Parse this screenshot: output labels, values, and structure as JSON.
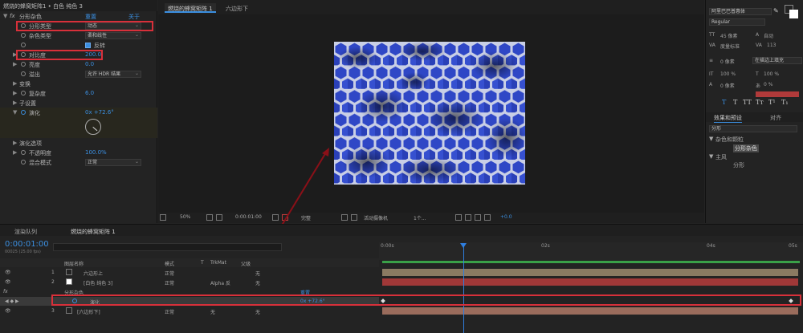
{
  "effect_controls": {
    "header": "燃烧的蜂窝矩阵1 • 白色 纯色 3",
    "effect_name": "分形杂色",
    "reset_label": "重置",
    "about_label": "关于",
    "rows": [
      {
        "label": "分形类型",
        "value": "动态",
        "kind": "dropdown"
      },
      {
        "label": "杂色类型",
        "value": "柔和线性",
        "kind": "dropdown"
      },
      {
        "label": "",
        "value": "反转",
        "kind": "checkbox"
      },
      {
        "label": "对比度",
        "value": "200.0",
        "kind": "number"
      },
      {
        "label": "亮度",
        "value": "0.0",
        "kind": "number"
      },
      {
        "label": "溢出",
        "value": "允许 HDR 结果",
        "kind": "dropdown"
      },
      {
        "label": "变换",
        "value": "",
        "kind": "group"
      },
      {
        "label": "复杂度",
        "value": "6.0",
        "kind": "number"
      },
      {
        "label": "子设置",
        "value": "",
        "kind": "group"
      },
      {
        "label": "演化",
        "value": "0x +72.6°",
        "kind": "angle"
      },
      {
        "label": "演化选项",
        "value": "",
        "kind": "group"
      },
      {
        "label": "不透明度",
        "value": "100.0%",
        "kind": "number"
      },
      {
        "label": "混合模式",
        "value": "正常",
        "kind": "dropdown"
      }
    ]
  },
  "viewer": {
    "comp_tab": "燃烧的蜂窝矩阵 1",
    "layer_tab": "六边形下",
    "toolbar": {
      "zoom": "50%",
      "time": "0:00:01:00",
      "resolution": "完整",
      "camera": "活动摄像机",
      "views": "1个...",
      "exposure": "+0.0"
    }
  },
  "character_panel": {
    "font": "阿里巴巴普惠体",
    "style": "Regular",
    "size": "45 像素",
    "leading": "自动",
    "kerning": "度量标准",
    "tracking": "113",
    "stroke_width": "0 像素",
    "stroke_mode": "在描边上填充",
    "vscale": "100 %",
    "hscale": "100 %",
    "baseline": "0 像素",
    "tsume": "0 %",
    "colors": {
      "fill": "#ffffff",
      "stroke": "#c03b3b"
    }
  },
  "effects_panel": {
    "tab_effects": "效果和预设",
    "tab_align": "对齐",
    "search_value": "分形",
    "category1": "杂色和颗粒",
    "item1": "分形杂色",
    "category2": "主风",
    "item2": "分形"
  },
  "timeline": {
    "tab_render": "渲染队列",
    "tab_comp": "燃烧的蜂窝矩阵 1",
    "current_time": "0:00:01:00",
    "fps_info": "00025 (25.00 fps)",
    "columns": {
      "name": "图层名称",
      "mode": "模式",
      "t": "T",
      "trkmat": "TrkMat",
      "parent": "父级"
    },
    "layers": [
      {
        "num": "1",
        "name": "六边形上",
        "mode": "正常",
        "trkmat": "",
        "parent": "无",
        "color": "#8a8a8a"
      },
      {
        "num": "2",
        "name": "[白色 纯色 3]",
        "mode": "正常",
        "trkmat": "Alpha 反",
        "parent": "无",
        "color": "#c03b3b"
      },
      {
        "num": "3",
        "name": "[六边形下]",
        "mode": "正常",
        "trkmat": "无",
        "parent": "无",
        "color": "#a07060"
      }
    ],
    "sub_effect": "分形杂色",
    "sub_reset": "重置",
    "sub_property": "演化",
    "sub_value": "0x +72.6°",
    "ruler": [
      "0:00s",
      "02s",
      "04s",
      "05s"
    ]
  }
}
